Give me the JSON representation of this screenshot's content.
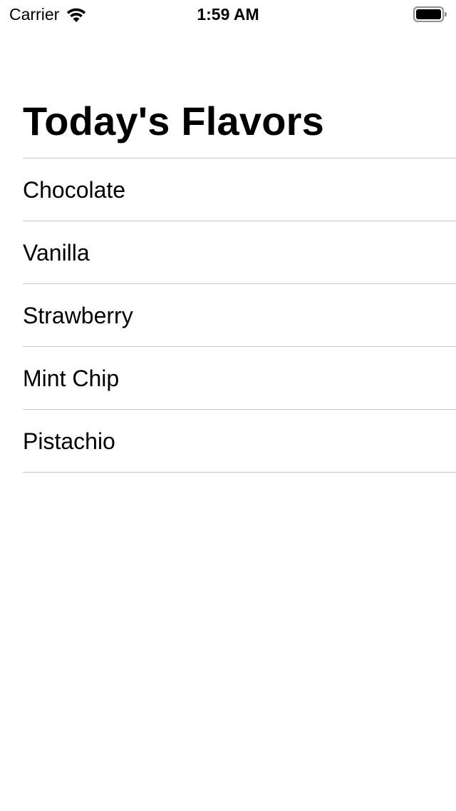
{
  "status_bar": {
    "carrier": "Carrier",
    "time": "1:59 AM",
    "wifi_icon": "wifi-icon",
    "battery_icon": "battery-full-icon"
  },
  "header": {
    "title": "Today's Flavors"
  },
  "flavors": {
    "items": [
      {
        "label": "Chocolate"
      },
      {
        "label": "Vanilla"
      },
      {
        "label": "Strawberry"
      },
      {
        "label": "Mint Chip"
      },
      {
        "label": "Pistachio"
      }
    ]
  },
  "colors": {
    "background": "#ffffff",
    "text": "#000000",
    "separator": "#c8c7cc"
  }
}
